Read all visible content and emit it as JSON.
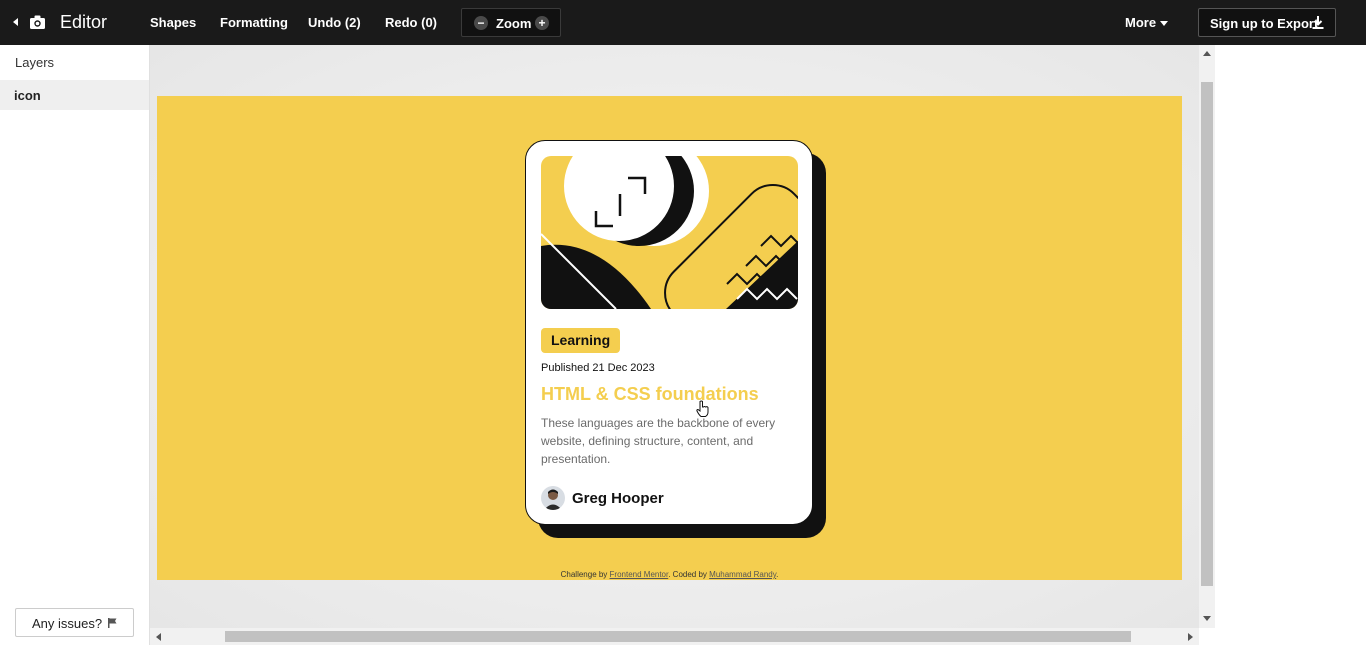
{
  "topbar": {
    "app_title": "Editor",
    "menu": {
      "shapes": "Shapes",
      "formatting": "Formatting",
      "undo": "Undo (2)",
      "redo": "Redo (0)"
    },
    "zoom": {
      "label": "Zoom",
      "minus": "−",
      "plus": "+"
    },
    "more": "More",
    "export": "Sign up to Export"
  },
  "sidebar": {
    "title": "Layers",
    "layers": [
      {
        "label": "icon"
      }
    ],
    "issues_button": "Any issues?"
  },
  "card": {
    "tag": "Learning",
    "published": "Published 21 Dec 2023",
    "title": "HTML & CSS foundations",
    "description": "These languages are the backbone of every website, defining structure, content, and presentation.",
    "author": "Greg Hooper"
  },
  "attribution": {
    "prefix": "Challenge by ",
    "challenge_link": "Frontend Mentor",
    "middle": ". Coded by ",
    "author_link": "Muhammad Randy",
    "suffix": "."
  },
  "colors": {
    "accent_yellow": "#f4ce4f",
    "topbar_bg": "#1a1a1a",
    "ink": "#111111"
  },
  "icons": [
    "back-arrow-icon",
    "camera-icon",
    "zoom-minus-icon",
    "zoom-plus-icon",
    "caret-down-icon",
    "download-icon",
    "flag-icon",
    "pointer-cursor-icon"
  ]
}
